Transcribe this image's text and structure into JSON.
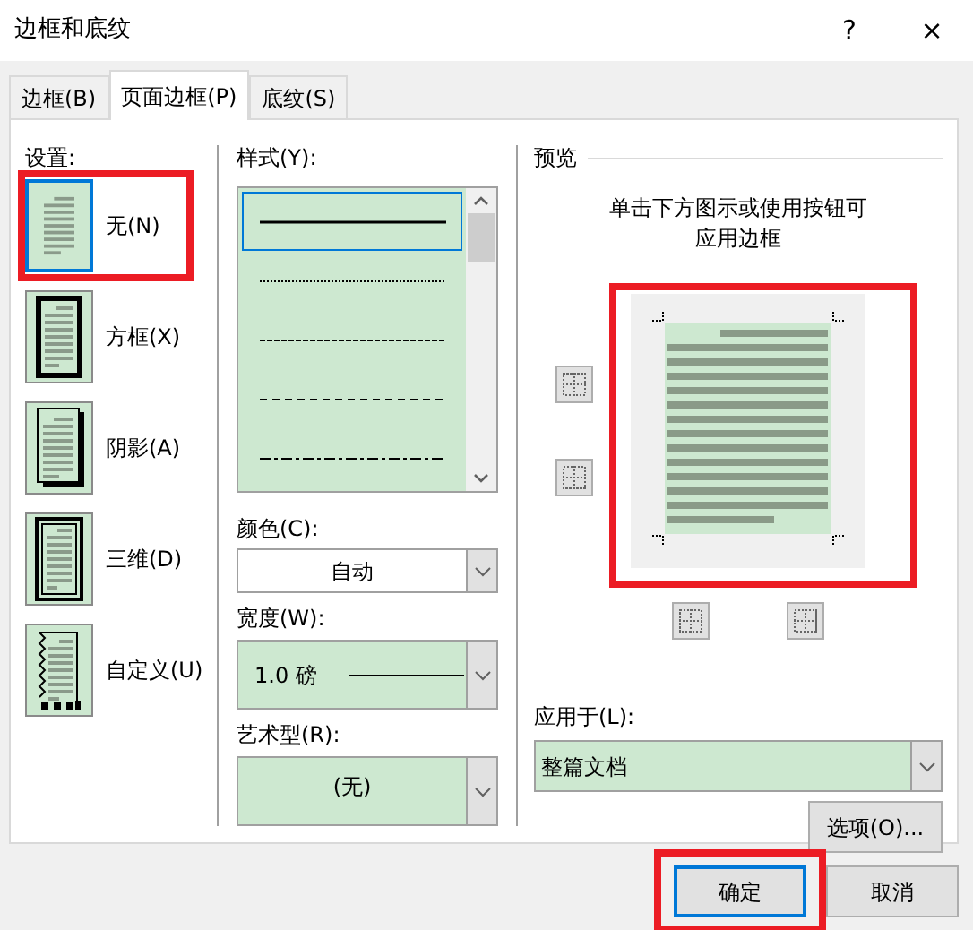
{
  "window": {
    "title": "边框和底纹",
    "help": "?",
    "close": "×"
  },
  "tabs": [
    {
      "label": "边框(B)",
      "selected": false
    },
    {
      "label": "页面边框(P)",
      "selected": true
    },
    {
      "label": "底纹(S)",
      "selected": false
    }
  ],
  "settings": {
    "label": "设置:",
    "items": [
      {
        "label": "无(N)",
        "kind": "none",
        "selected": true,
        "highlighted": true
      },
      {
        "label": "方框(X)",
        "kind": "box",
        "selected": false,
        "highlighted": false
      },
      {
        "label": "阴影(A)",
        "kind": "shadow",
        "selected": false,
        "highlighted": false
      },
      {
        "label": "三维(D)",
        "kind": "raised",
        "selected": false,
        "highlighted": false
      },
      {
        "label": "自定义(U)",
        "kind": "custom",
        "selected": false,
        "highlighted": false
      }
    ]
  },
  "style": {
    "label": "样式(Y):",
    "options": [
      {
        "kind": "solid",
        "selected": true
      },
      {
        "kind": "dotted",
        "selected": false
      },
      {
        "kind": "fine-dashed",
        "selected": false
      },
      {
        "kind": "dashed",
        "selected": false
      },
      {
        "kind": "dash-dot",
        "selected": false
      }
    ]
  },
  "color": {
    "label": "颜色(C):",
    "value": "自动"
  },
  "width": {
    "label": "宽度(W):",
    "value": "1.0 磅"
  },
  "art": {
    "label": "艺术型(R):",
    "value": "(无)"
  },
  "preview": {
    "label": "预览",
    "hint": [
      "单击下方图示或使用按钮可",
      "应用边框"
    ],
    "highlighted": true
  },
  "apply_to": {
    "label": "应用于(L):",
    "value": "整篇文档"
  },
  "options_button": "选项(O)...",
  "buttons": [
    {
      "label": "确定",
      "default": true,
      "highlighted": true
    },
    {
      "label": "取消",
      "default": false,
      "highlighted": false
    }
  ]
}
